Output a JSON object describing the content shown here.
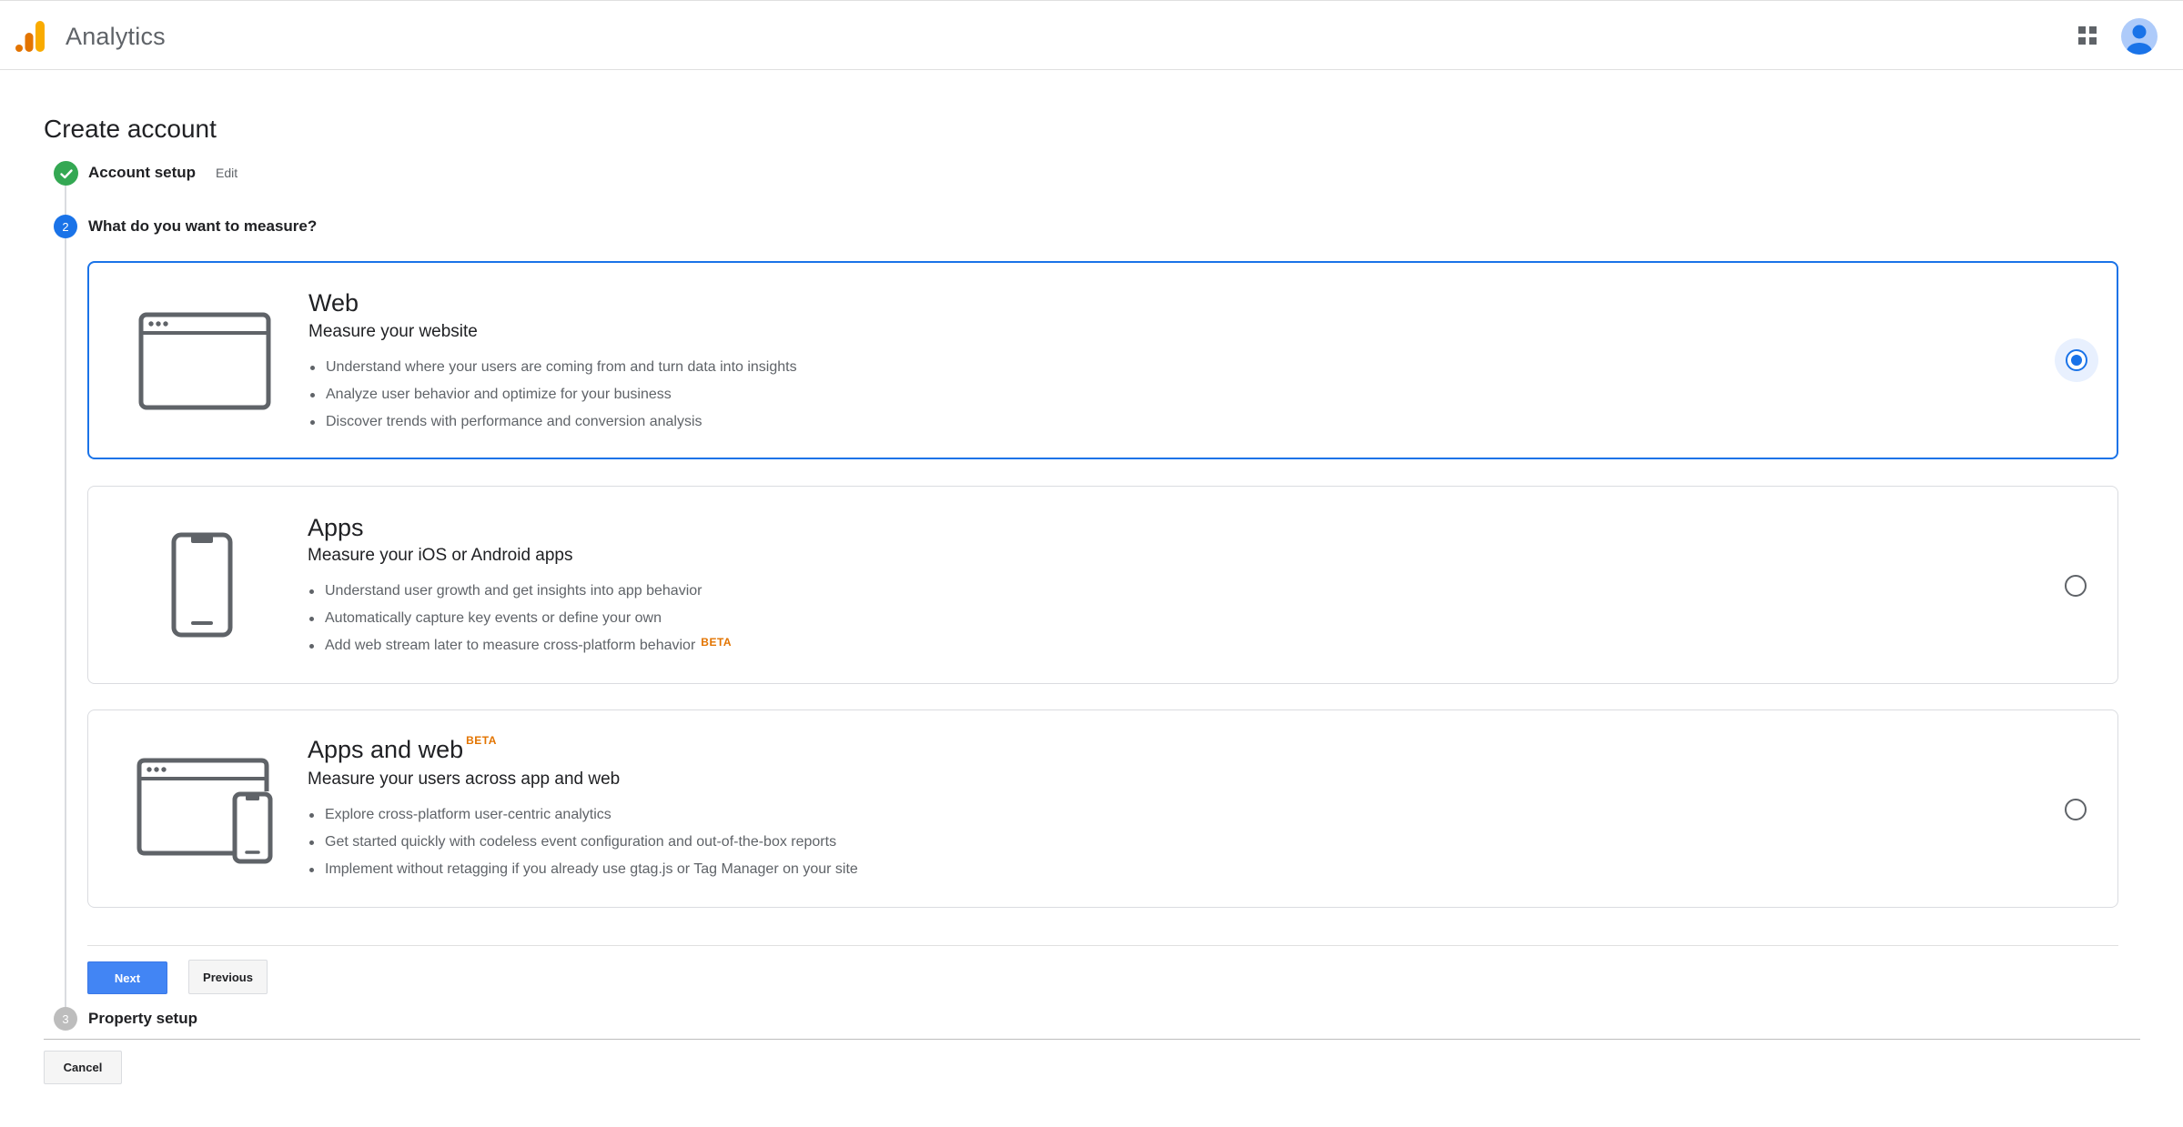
{
  "header": {
    "app_title": "Analytics",
    "logo_colors": [
      "#f9ab00",
      "#e37400"
    ],
    "icons": [
      "apps-grid-icon",
      "account-avatar-icon"
    ]
  },
  "page": {
    "title": "Create account"
  },
  "steps": [
    {
      "number": "",
      "label": "Account setup",
      "state": "done",
      "edit_label": "Edit",
      "icon": "check-icon"
    },
    {
      "number": "2",
      "label": "What do you want to measure?",
      "state": "active"
    },
    {
      "number": "3",
      "label": "Property setup",
      "state": "pending"
    }
  ],
  "options": [
    {
      "title": "Web",
      "subtitle": "Measure your website",
      "selected": true,
      "icon": "browser-window-icon",
      "bullets": [
        "Understand where your users are coming from and turn data into insights",
        "Analyze user behavior and optimize for your business",
        "Discover trends with performance and conversion analysis"
      ]
    },
    {
      "title": "Apps",
      "subtitle": "Measure your iOS or Android apps",
      "selected": false,
      "icon": "phone-icon",
      "bullets": [
        "Understand user growth and get insights into app behavior",
        "Automatically capture key events or define your own",
        "Add web stream later to measure cross-platform behavior"
      ],
      "bullet_badge": "BETA"
    },
    {
      "title": "Apps and web",
      "title_badge": "BETA",
      "subtitle": "Measure your users across app and web",
      "selected": false,
      "icon": "browser-and-phone-icon",
      "bullets": [
        "Explore cross-platform user-centric analytics",
        "Get started quickly with codeless event configuration and out-of-the-box reports",
        "Implement without retagging if you already use gtag.js or Tag Manager on your site"
      ]
    }
  ],
  "buttons": {
    "next": "Next",
    "previous": "Previous",
    "cancel": "Cancel"
  },
  "colors": {
    "accent": "#1a73e8",
    "done": "#34a853",
    "beta": "#e37400",
    "next_button": "#4285f4"
  }
}
